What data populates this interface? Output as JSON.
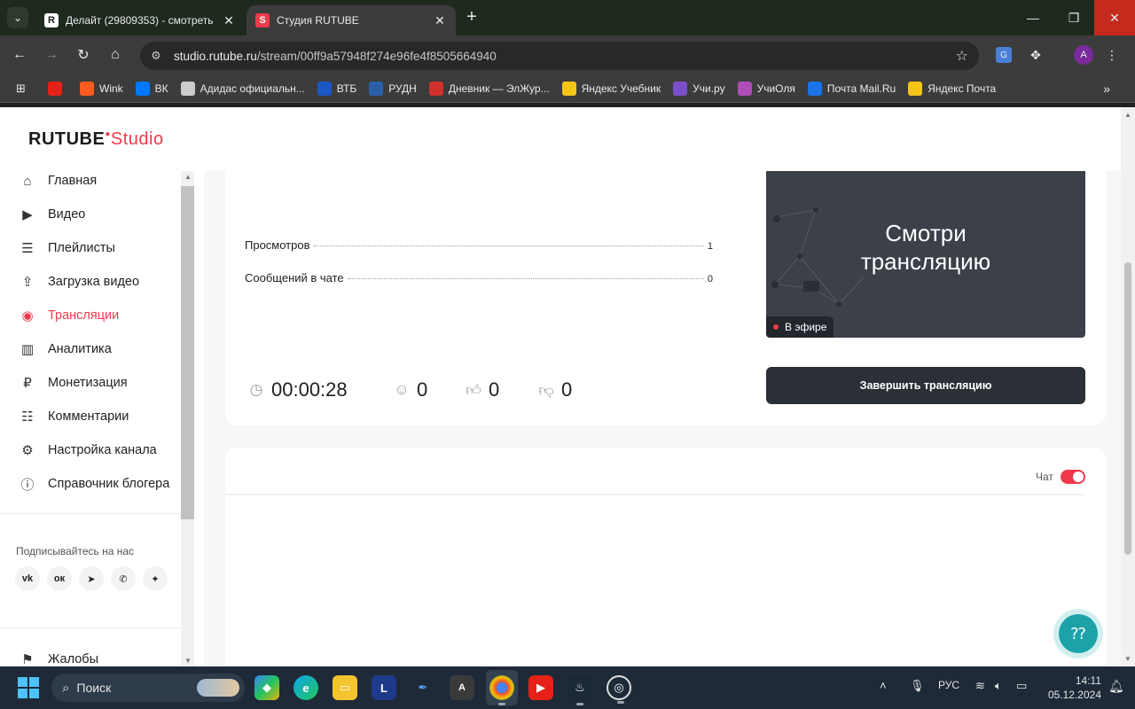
{
  "browser": {
    "tabs": [
      {
        "title": "Делайт (29809353) - смотреть",
        "favicon": "R",
        "active": false
      },
      {
        "title": "Студия RUTUBE",
        "favicon": "S",
        "active": true
      }
    ],
    "new_tab": "+",
    "url_host": "studio.rutube.ru",
    "url_path": "/stream/00ff9a57948f274e96fe4f8505664940",
    "profile_initial": "A",
    "bookmarks": [
      {
        "label": "",
        "color": "#e62117",
        "icon": "youtube-icon"
      },
      {
        "label": "Wink",
        "color": "#ff5a1f",
        "icon": "wink-icon"
      },
      {
        "label": "ВК",
        "color": "#0077ff",
        "icon": "vk-icon"
      },
      {
        "label": "Адидас официальн...",
        "color": "#cccccc",
        "icon": "adidas-icon"
      },
      {
        "label": "ВТБ",
        "color": "#1a56c4",
        "icon": "vtb-icon"
      },
      {
        "label": "РУДН",
        "color": "#2b5fa8",
        "icon": "rudn-icon"
      },
      {
        "label": "Дневник — ЭлЖур...",
        "color": "#d0312d",
        "icon": "diary-icon"
      },
      {
        "label": "Яндекс Учебник",
        "color": "#f5c518",
        "icon": "yandex-textbook-icon"
      },
      {
        "label": "Учи.ру",
        "color": "#7a4fc9",
        "icon": "uchi-icon"
      },
      {
        "label": "УчиОля",
        "color": "#b04db8",
        "icon": "uchiolya-icon"
      },
      {
        "label": "Почта Mail.Ru",
        "color": "#1a73e8",
        "icon": "mailru-icon"
      },
      {
        "label": "Яндекс Почта",
        "color": "#f5c518",
        "icon": "yandex-mail-icon"
      }
    ]
  },
  "studio": {
    "brand_main": "RUTUBE",
    "brand_sub": "Studio",
    "accent_color": "#ef3a4b",
    "nav": [
      {
        "label": "Главная",
        "icon": "home-icon",
        "glyph": "⌂",
        "active": false
      },
      {
        "label": "Видео",
        "icon": "video-icon",
        "glyph": "▶",
        "active": false
      },
      {
        "label": "Плейлисты",
        "icon": "playlist-icon",
        "glyph": "☰",
        "active": false
      },
      {
        "label": "Загрузка видео",
        "icon": "upload-icon",
        "glyph": "⇪",
        "active": false
      },
      {
        "label": "Трансляции",
        "icon": "broadcast-icon",
        "glyph": "◉",
        "active": true
      },
      {
        "label": "Аналитика",
        "icon": "analytics-icon",
        "glyph": "▥",
        "active": false
      },
      {
        "label": "Монетизация",
        "icon": "ruble-icon",
        "glyph": "₽",
        "active": false
      },
      {
        "label": "Комментарии",
        "icon": "comments-icon",
        "glyph": "☷",
        "active": false
      },
      {
        "label": "Настройка канала",
        "icon": "gear-icon",
        "glyph": "⚙",
        "active": false
      },
      {
        "label": "Справочник блогера",
        "icon": "info-icon",
        "glyph": "ⓘ",
        "active": false
      }
    ],
    "follow_label": "Подписывайтесь на нас",
    "socials": [
      {
        "name": "vk-social-icon",
        "glyph": "vk"
      },
      {
        "name": "ok-social-icon",
        "glyph": "ок"
      },
      {
        "name": "telegram-social-icon",
        "glyph": "➤"
      },
      {
        "name": "viber-social-icon",
        "glyph": "✆"
      },
      {
        "name": "dzen-social-icon",
        "glyph": "✦"
      }
    ],
    "complaints_label": "Жалобы",
    "stats": [
      {
        "label": "Просмотров",
        "value": "1"
      },
      {
        "label": "Сообщений в чате",
        "value": "0"
      }
    ],
    "metrics": {
      "duration": "00:00:28",
      "viewers": "0",
      "likes": "0",
      "dislikes": "0"
    },
    "preview": {
      "title_line1": "Смотри",
      "title_line2": "трансляцию",
      "live_label": "В эфире"
    },
    "end_button": "Завершить трансляцию",
    "chat_label": "Чат",
    "chat_enabled": true
  },
  "taskbar": {
    "search_placeholder": "Поиск",
    "language": "РУС",
    "time": "14:11",
    "date": "05.12.2024"
  }
}
